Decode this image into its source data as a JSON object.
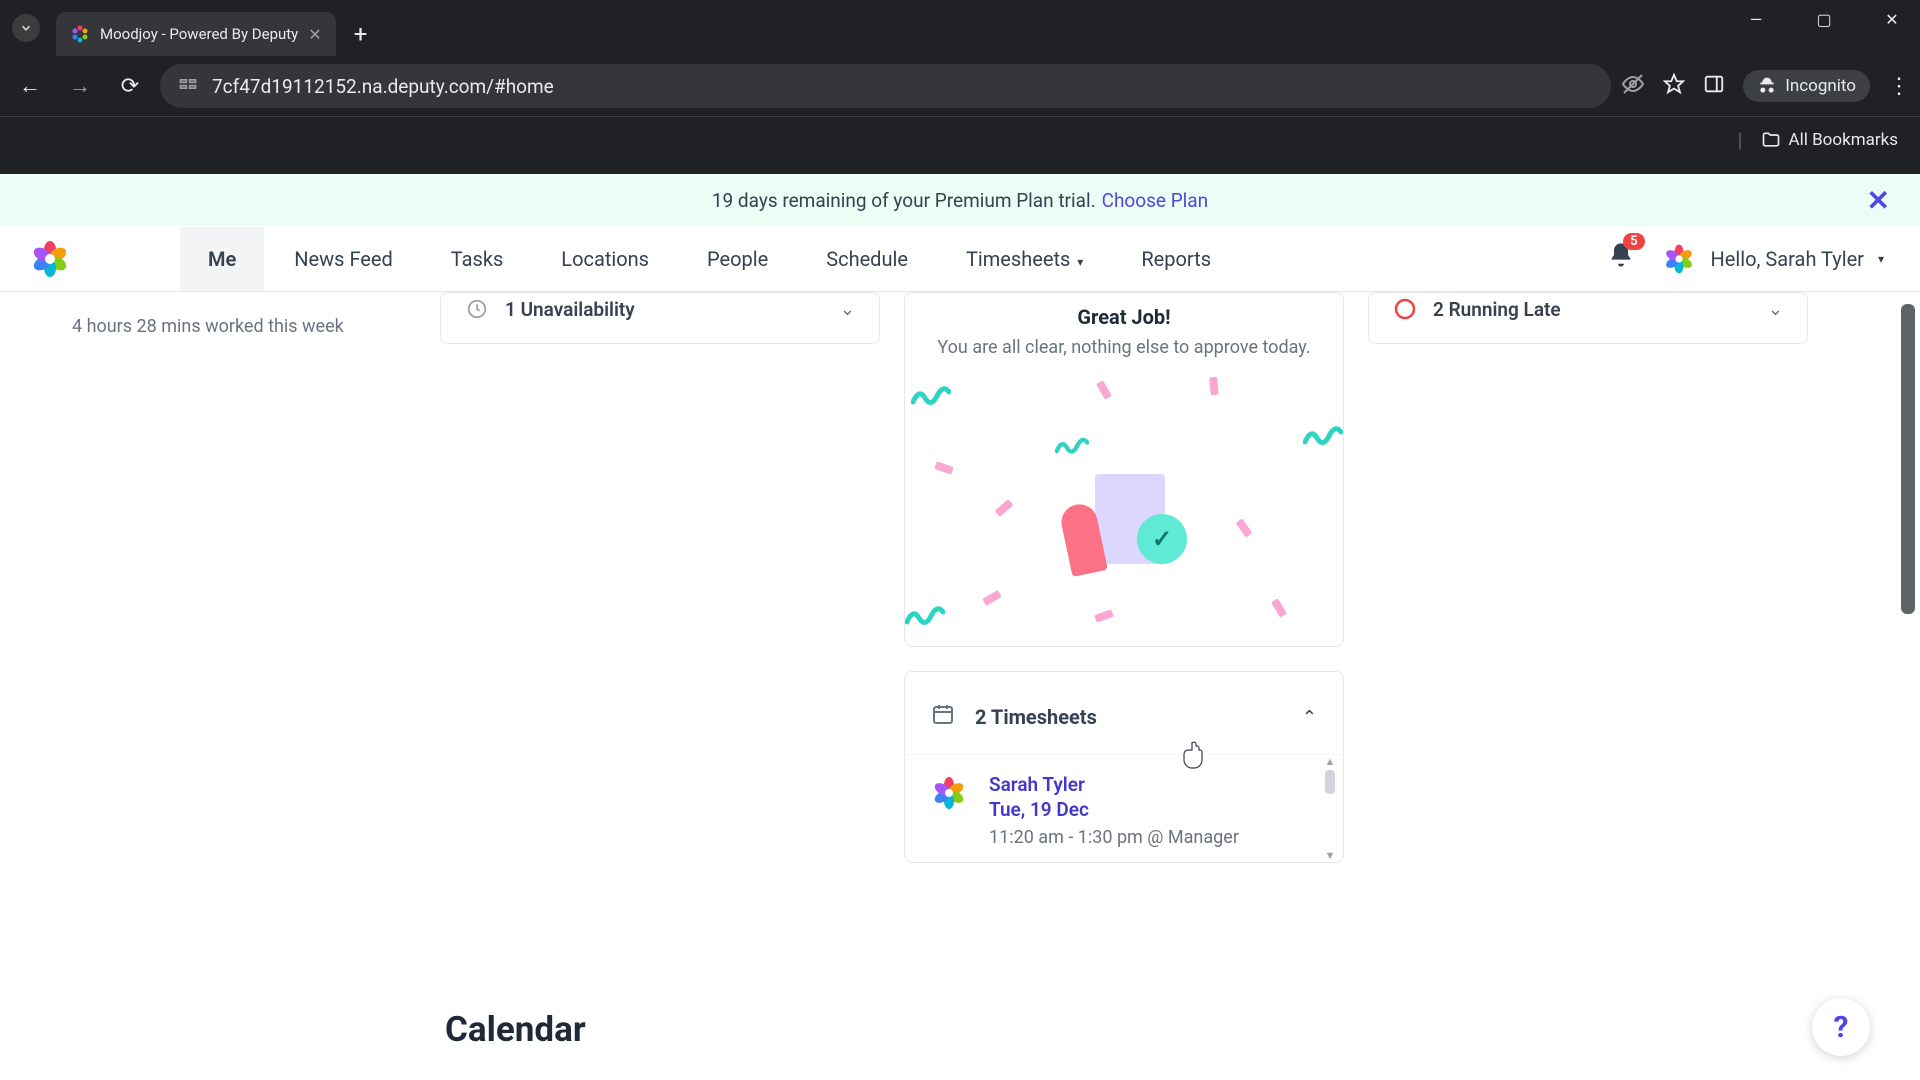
{
  "browser": {
    "tab_title": "Moodjoy - Powered By Deputy",
    "url": "7cf47d19112152.na.deputy.com/#home",
    "incognito_label": "Incognito",
    "bookmarks_label": "All Bookmarks"
  },
  "banner": {
    "text": "19 days remaining of your Premium Plan trial.",
    "link": "Choose Plan"
  },
  "nav": {
    "items": [
      "Me",
      "News Feed",
      "Tasks",
      "Locations",
      "People",
      "Schedule",
      "Timesheets",
      "Reports"
    ],
    "active_index": 0,
    "dropdown_indices": [
      6
    ]
  },
  "header": {
    "bell_count": "5",
    "greeting": "Hello, Sarah Tyler"
  },
  "sidebar": {
    "hours_text": "4 hours 28 mins worked this week"
  },
  "unavailability_card": {
    "title": "1 Unavailability"
  },
  "great_job": {
    "title": "Great Job!",
    "subtitle": "You are all clear, nothing else to approve today."
  },
  "timesheets_card": {
    "title": "2 Timesheets",
    "items": [
      {
        "name": "Sarah Tyler",
        "date": "Tue, 19 Dec",
        "meta": "11:20 am - 1:30 pm @ Manager"
      }
    ]
  },
  "running_late_card": {
    "title": "2 Running Late"
  },
  "calendar_heading": "Calendar",
  "help_label": "?"
}
